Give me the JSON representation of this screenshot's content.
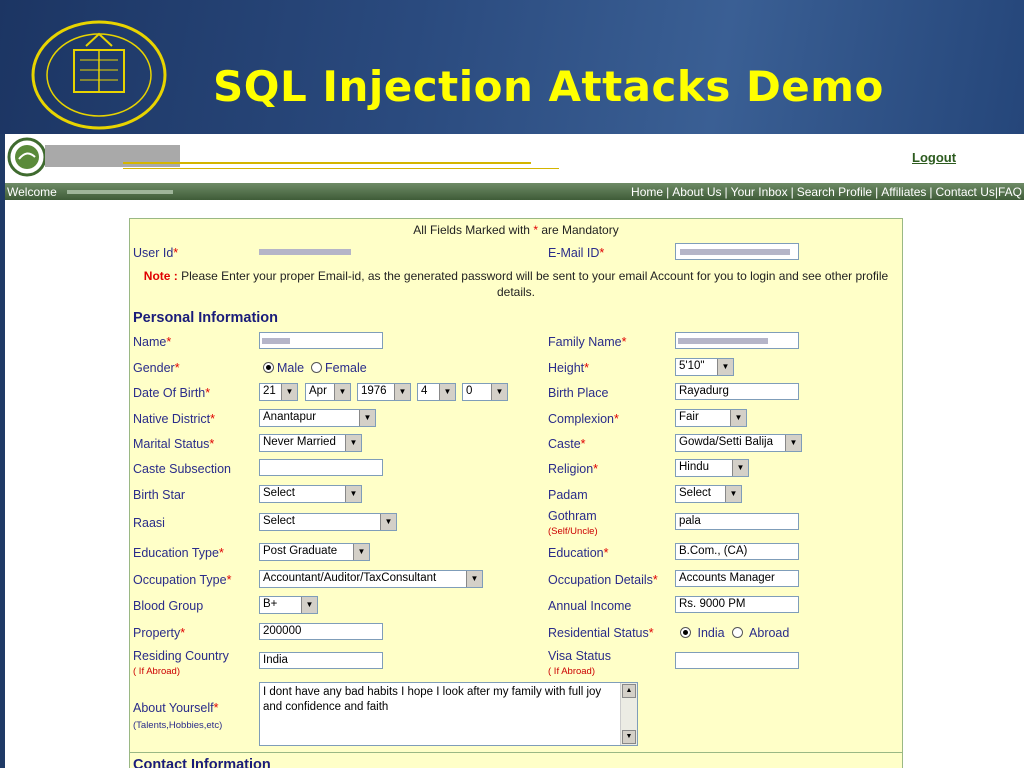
{
  "slide": {
    "title": "SQL Injection Attacks Demo"
  },
  "site": {
    "logout": "Logout",
    "welcome": "Welcome",
    "nav": [
      "Home",
      "About Us",
      "Your Inbox",
      "Search Profile",
      "Affiliates",
      "Contact Us",
      "FAQ"
    ]
  },
  "form": {
    "mandatory_prefix": "All Fields Marked with ",
    "mandatory_star": "*",
    "mandatory_suffix": " are Mandatory",
    "note_label": "Note :",
    "note_text": " Please Enter your proper Email-id, as the generated password will be sent to your email Account for you to login and see other profile details.",
    "personal_heading": "Personal Information",
    "contact_heading": "Contact Information",
    "labels": {
      "user_id": "User Id",
      "email": "E-Mail ID",
      "name": "Name",
      "family_name": "Family Name",
      "gender": "Gender",
      "height": "Height",
      "dob": "Date Of Birth",
      "birth_place": "Birth Place",
      "native_district": "Native District",
      "complexion": "Complexion",
      "marital_status": "Marital Status",
      "caste": "Caste",
      "caste_subsection": "Caste Subsection",
      "religion": "Religion",
      "birth_star": "Birth Star",
      "padam": "Padam",
      "raasi": "Raasi",
      "gothram": "Gothram",
      "gothram_sub": "(Self/Uncle)",
      "education_type": "Education Type",
      "education": "Education",
      "occupation_type": "Occupation Type",
      "occupation_details": "Occupation Details",
      "blood_group": "Blood Group",
      "annual_income": "Annual Income",
      "property": "Property",
      "residential_status": "Residential Status",
      "residing_country": "Residing Country",
      "if_abroad": "( If Abroad)",
      "visa_status": "Visa Status",
      "about": "About Yourself",
      "about_sub": "(Talents,Hobbies,etc)"
    },
    "values": {
      "gender_male": "Male",
      "gender_female": "Female",
      "height": "5'10\"",
      "dob_day": "21",
      "dob_month": "Apr",
      "dob_year": "1976",
      "dob_4": "4",
      "dob_5": "0",
      "birth_place": "Rayadurg",
      "native_district": "Anantapur",
      "complexion": "Fair",
      "marital_status": "Never Married",
      "caste": "Gowda/Setti Balija",
      "caste_subsection": "",
      "religion": "Hindu",
      "birth_star": "Select",
      "padam": "Select",
      "raasi": "Select",
      "gothram": "pala",
      "education_type": "Post Graduate",
      "education": "B.Com., (CA)",
      "occupation_type": "Accountant/Auditor/TaxConsultant",
      "occupation_details": "Accounts Manager",
      "blood_group": "B+",
      "annual_income": "Rs. 9000 PM",
      "property": "200000",
      "res_india": "India",
      "res_abroad": "Abroad",
      "residing_country": "India",
      "visa_status": "",
      "about": "I dont have any bad habits I hope I look after my family with full joy and confidence and faith"
    }
  }
}
